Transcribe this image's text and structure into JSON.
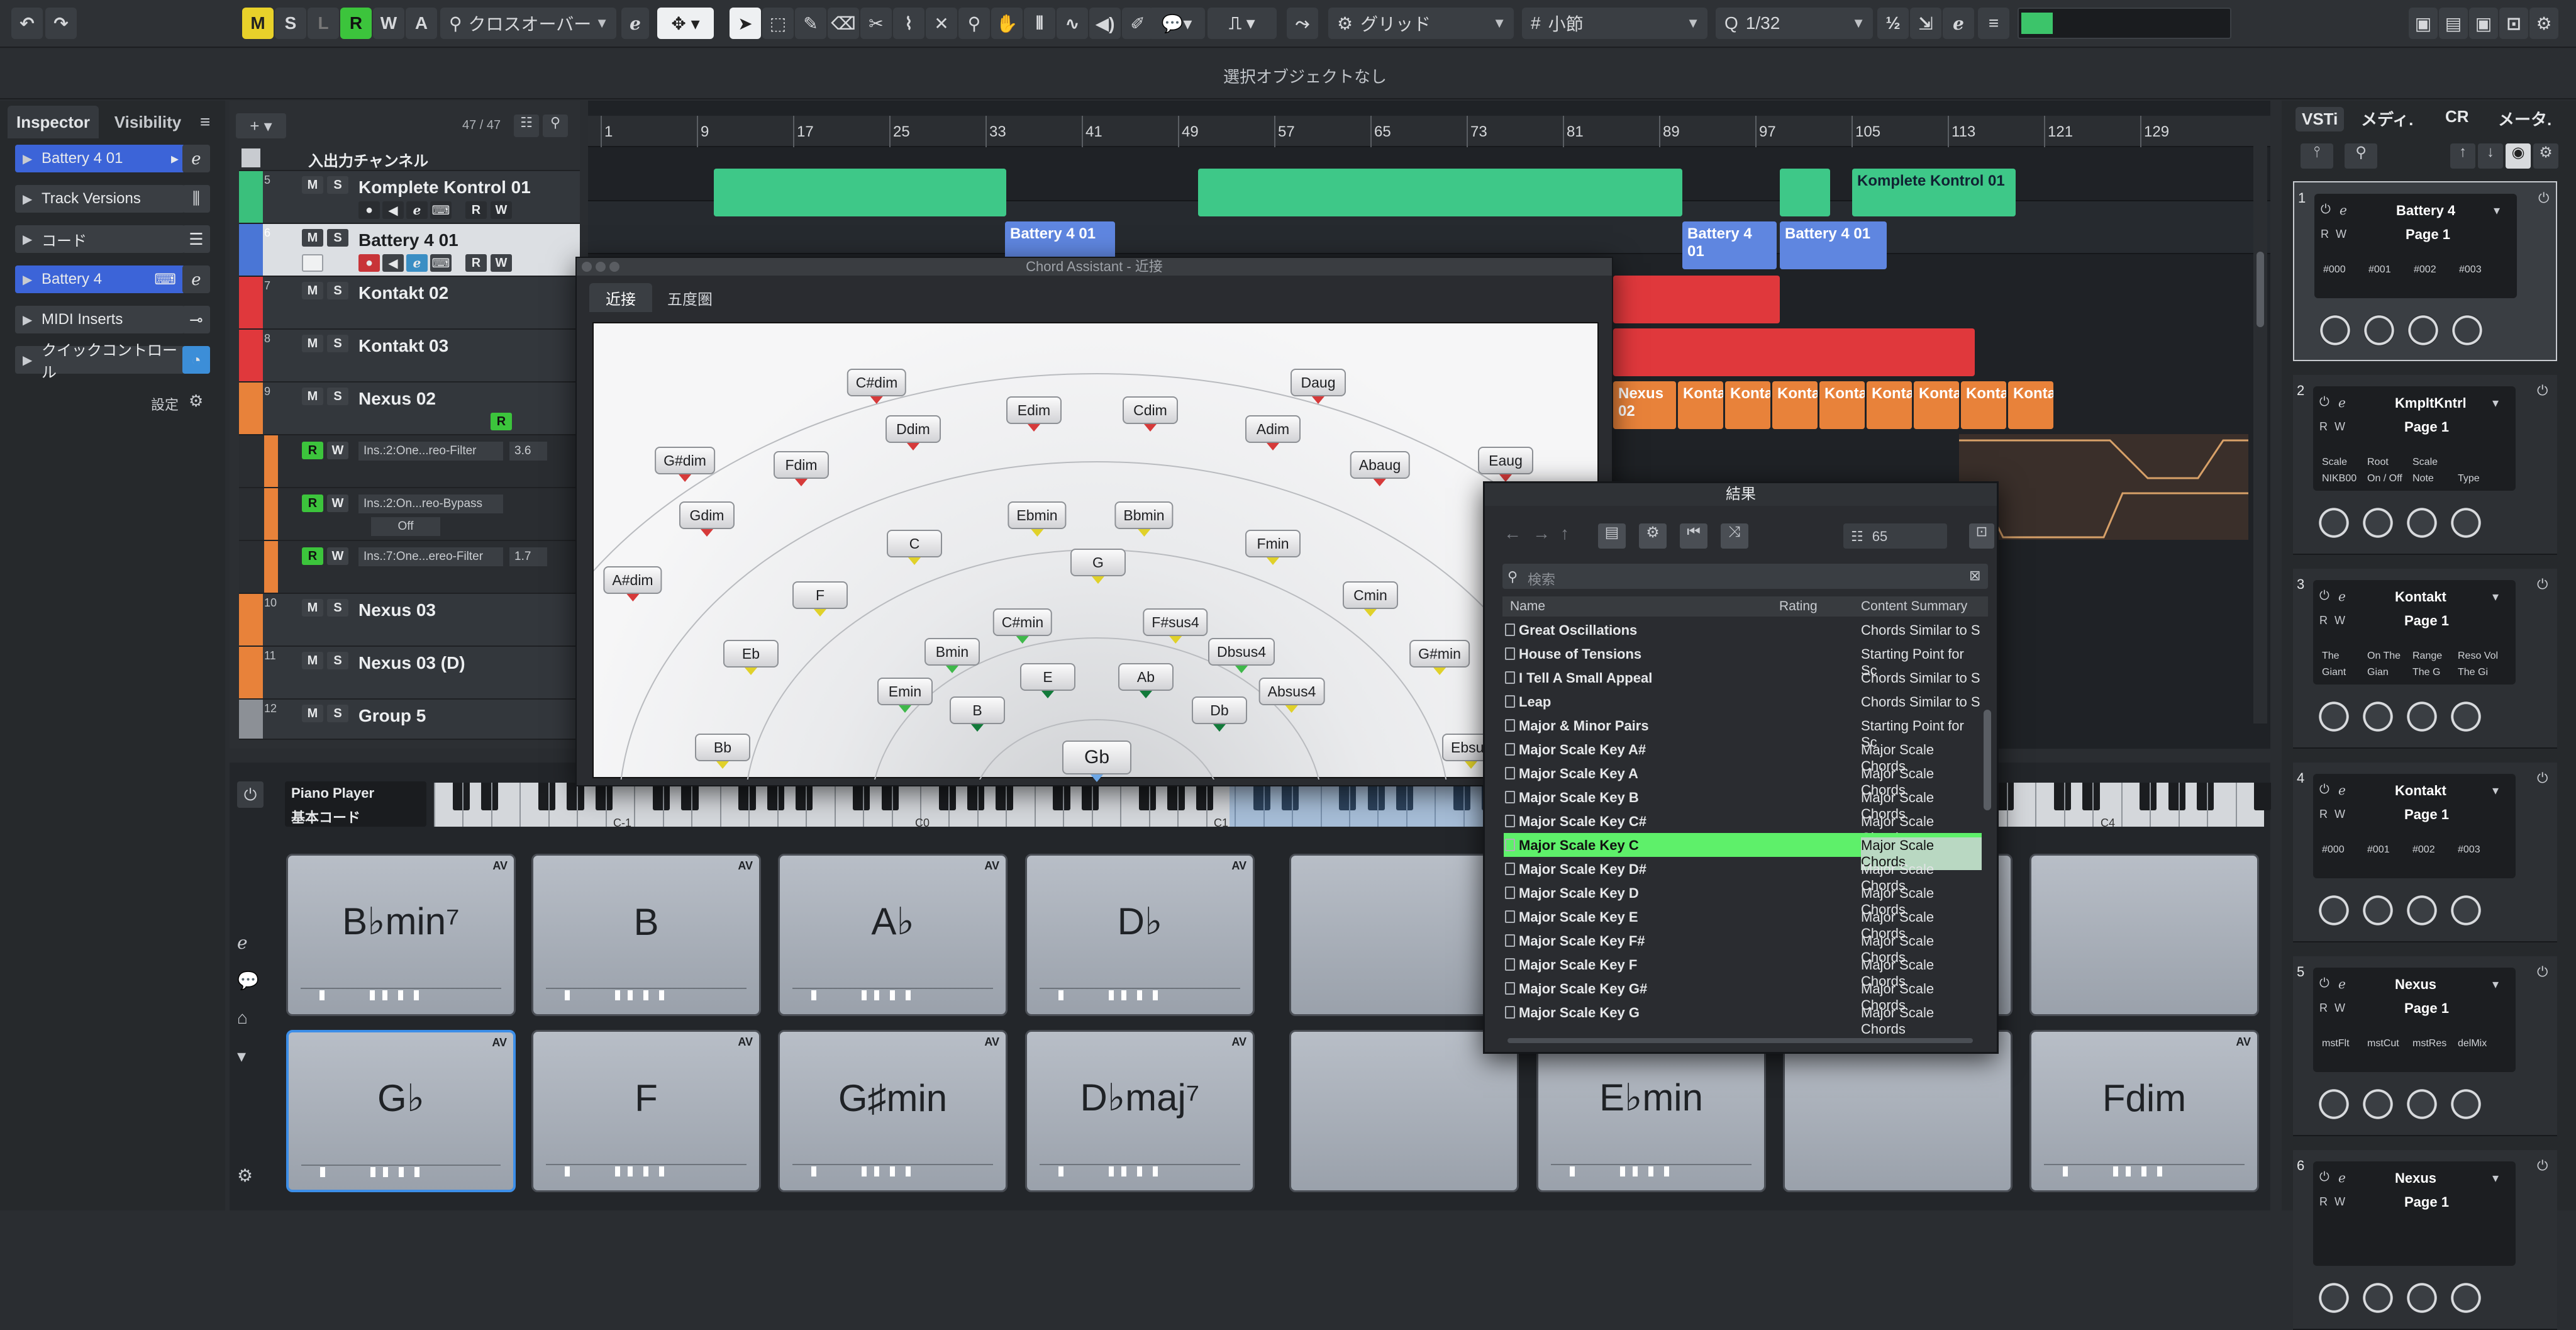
{
  "toolbar": {
    "states": [
      "M",
      "S",
      "L",
      "R",
      "W",
      "A"
    ],
    "crossover": "クロスオーバー",
    "grid_type": "グリッド",
    "grid_value": "小節",
    "quantize": "1/32"
  },
  "info_line": "選択オブジェクトなし",
  "inspector": {
    "tabs": [
      "Inspector",
      "Visibility"
    ],
    "sections": [
      "Battery 4 01",
      "Track Versions",
      "コード",
      "Battery 4",
      "MIDI Inserts",
      "クイックコントロール"
    ],
    "settings": "設定"
  },
  "tracklist": {
    "count": "47 / 47",
    "header": "入出力チャンネル",
    "tracks": [
      {
        "num": "5",
        "name": "Komplete Kontrol 01",
        "color": "#3ac07c"
      },
      {
        "num": "6",
        "name": "Battery 4 01",
        "color": "#4a76d6"
      },
      {
        "num": "7",
        "name": "Kontakt 02",
        "color": "#e0383c"
      },
      {
        "num": "8",
        "name": "Kontakt 03",
        "color": "#e0383c"
      },
      {
        "num": "9",
        "name": "Nexus 02",
        "color": "#e8823a"
      }
    ],
    "automation": [
      {
        "name": "Ins.:2:One...reo-Filter",
        "value": "3.6"
      },
      {
        "name": "Ins.:2:On...reo-Bypass",
        "value": "Off"
      },
      {
        "name": "Ins.:7:One...ereo-Filter",
        "value": "1.7"
      }
    ],
    "tracks2": [
      {
        "num": "10",
        "name": "Nexus 03"
      },
      {
        "num": "11",
        "name": "Nexus 03 (D)"
      },
      {
        "num": "12",
        "name": "Group 5"
      }
    ]
  },
  "ruler": [
    "1",
    "9",
    "17",
    "25",
    "33",
    "41",
    "49",
    "57",
    "65",
    "73",
    "81",
    "89",
    "97",
    "105",
    "113",
    "121",
    "129"
  ],
  "clips": {
    "komplete": "Komplete Kontrol 01",
    "battery": "Battery 4 01",
    "nexus": "Nexus 02",
    "konta": "Konta"
  },
  "chord_assistant": {
    "title": "Chord Assistant - 近接",
    "tabs": [
      "近接",
      "五度圏"
    ],
    "center": "Gb",
    "nodes": [
      {
        "label": "C#dim",
        "c": "r"
      },
      {
        "label": "Daug",
        "c": "r"
      },
      {
        "label": "Edim",
        "c": "r"
      },
      {
        "label": "Cdim",
        "c": "r"
      },
      {
        "label": "Ddim",
        "c": "r"
      },
      {
        "label": "Adim",
        "c": "r"
      },
      {
        "label": "G#dim",
        "c": "r"
      },
      {
        "label": "Fdim",
        "c": "r"
      },
      {
        "label": "Abaug",
        "c": "r"
      },
      {
        "label": "Eaug",
        "c": "r"
      },
      {
        "label": "Gdim",
        "c": "r"
      },
      {
        "label": "A#dim",
        "c": "r"
      },
      {
        "label": "C",
        "c": "y"
      },
      {
        "label": "Ebmin",
        "c": "y"
      },
      {
        "label": "Bbmin",
        "c": "y"
      },
      {
        "label": "Fmin",
        "c": "y"
      },
      {
        "label": "G",
        "c": "y"
      },
      {
        "label": "F",
        "c": "y"
      },
      {
        "label": "Cmin",
        "c": "y"
      },
      {
        "label": "C#min",
        "c": "g"
      },
      {
        "label": "F#sus4",
        "c": "y"
      },
      {
        "label": "Bmin",
        "c": "g"
      },
      {
        "label": "Dbsus4",
        "c": "g"
      },
      {
        "label": "Eb",
        "c": "y"
      },
      {
        "label": "G#min",
        "c": "y"
      },
      {
        "label": "E",
        "c": "dk"
      },
      {
        "label": "Ab",
        "c": "dk"
      },
      {
        "label": "Emin",
        "c": "g"
      },
      {
        "label": "Absus4",
        "c": "y"
      },
      {
        "label": "B",
        "c": "dk"
      },
      {
        "label": "Db",
        "c": "dk"
      },
      {
        "label": "Bb",
        "c": "y"
      },
      {
        "label": "Ebsus",
        "c": "y"
      },
      {
        "label": "Gb",
        "c": "b"
      }
    ]
  },
  "results": {
    "title": "結果",
    "count": "65",
    "search_placeholder": "検索",
    "columns": [
      "Name",
      "Rating",
      "Content Summary"
    ],
    "rows": [
      {
        "name": "Great Oscillations",
        "summary": "Chords Similar to S"
      },
      {
        "name": "House of Tensions",
        "summary": "Starting Point for Sc"
      },
      {
        "name": "I Tell A Small Appeal",
        "summary": "Chords Similar to S"
      },
      {
        "name": "Leap",
        "summary": "Chords Similar to S"
      },
      {
        "name": "Major & Minor Pairs",
        "summary": "Starting Point for Sc"
      },
      {
        "name": "Major Scale Key A#",
        "summary": "Major Scale Chords"
      },
      {
        "name": "Major Scale Key A",
        "summary": "Major Scale Chords"
      },
      {
        "name": "Major Scale Key B",
        "summary": "Major Scale Chords"
      },
      {
        "name": "Major Scale Key C#",
        "summary": "Major Scale Chords"
      },
      {
        "name": "Major Scale Key C",
        "summary": "Major Scale Chords",
        "selected": true
      },
      {
        "name": "Major Scale Key D#",
        "summary": "Major Scale Chords"
      },
      {
        "name": "Major Scale Key D",
        "summary": "Major Scale Chords"
      },
      {
        "name": "Major Scale Key E",
        "summary": "Major Scale Chords"
      },
      {
        "name": "Major Scale Key F#",
        "summary": "Major Scale Chords"
      },
      {
        "name": "Major Scale Key F",
        "summary": "Major Scale Chords"
      },
      {
        "name": "Major Scale Key G#",
        "summary": "Major Scale Chords"
      },
      {
        "name": "Major Scale Key G",
        "summary": "Major Scale Chords"
      }
    ]
  },
  "chord_pads": {
    "player": "Piano Player",
    "voicing": "基本コード",
    "keys": [
      "C-1",
      "C0",
      "C1",
      "C4"
    ],
    "pads_row1": [
      "B♭min⁷",
      "B",
      "A♭",
      "D♭",
      "",
      "",
      "",
      ""
    ],
    "pads_row2": [
      "G♭",
      "F",
      "G♯min",
      "D♭maj⁷",
      "",
      "E♭min",
      "",
      "Fdim"
    ],
    "av": "AV"
  },
  "vsti": {
    "tabs": [
      "VSTi",
      "メディ.",
      "CR",
      "メータ."
    ],
    "slots": [
      {
        "num": "1",
        "name": "Battery 4",
        "page": "Page 1",
        "params": [
          "#000",
          "#001",
          "#002",
          "#003"
        ],
        "params2": []
      },
      {
        "num": "2",
        "name": "KmpltKntrl",
        "page": "Page 1",
        "params": [
          "Scale",
          "Root",
          "Scale"
        ],
        "params2": [
          "NIKB00",
          "On / Off",
          "Note",
          "Type"
        ]
      },
      {
        "num": "3",
        "name": "Kontakt",
        "page": "Page 1",
        "params": [
          "The",
          "On The",
          "Range",
          "Reso Vol"
        ],
        "params2": [
          "Giant",
          "Gian",
          "The G",
          "The Gi"
        ]
      },
      {
        "num": "4",
        "name": "Kontakt",
        "page": "Page 1",
        "params": [
          "#000",
          "#001",
          "#002",
          "#003"
        ],
        "params2": []
      },
      {
        "num": "5",
        "name": "Nexus",
        "page": "Page 1",
        "params": [
          "mstFlt",
          "mstCut",
          "mstRes",
          "delMix"
        ],
        "params2": []
      },
      {
        "num": "6",
        "name": "Nexus",
        "page": "Page 1",
        "params": [],
        "params2": []
      }
    ]
  }
}
